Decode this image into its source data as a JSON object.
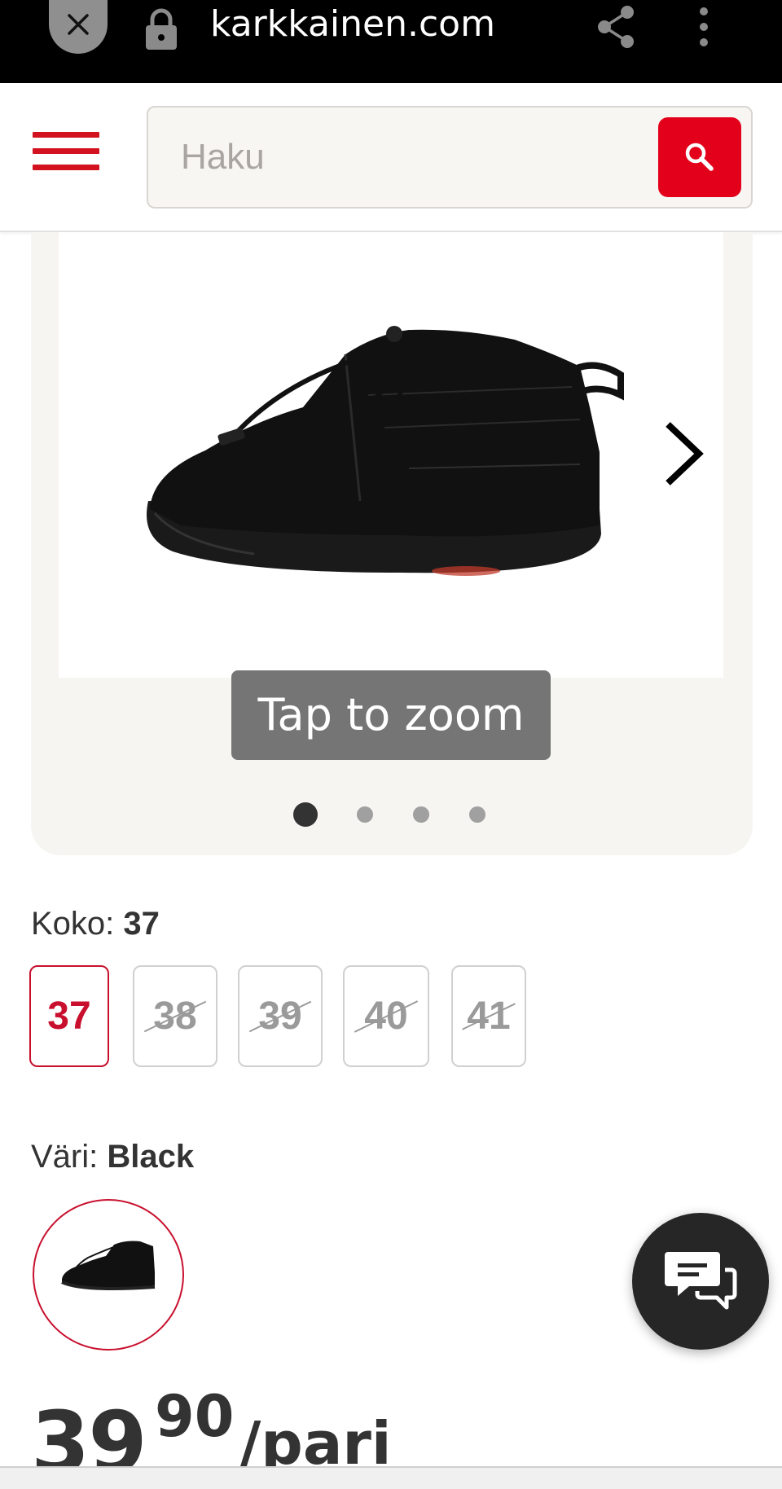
{
  "browser": {
    "url": "karkkainen.com",
    "icons": [
      "close-icon",
      "lock-icon",
      "share-icon",
      "more-vert-icon"
    ]
  },
  "header": {
    "search_placeholder": "Haku",
    "search_value": "",
    "icons": [
      "hamburger-menu-icon",
      "search-icon"
    ],
    "accent_color": "#e2001a"
  },
  "gallery": {
    "zoom_hint": "Tap to zoom",
    "slide_count": 4,
    "active_slide": 1,
    "icons": [
      "chevron-right-icon"
    ]
  },
  "size": {
    "label": "Koko: ",
    "selected": "37",
    "options": [
      {
        "label": "37",
        "available": true,
        "selected": true
      },
      {
        "label": "38",
        "available": false,
        "selected": false
      },
      {
        "label": "39",
        "available": false,
        "selected": false
      },
      {
        "label": "40",
        "available": false,
        "selected": false
      },
      {
        "label": "41",
        "available": false,
        "selected": false
      }
    ]
  },
  "color": {
    "label": "Väri: ",
    "selected": "Black"
  },
  "chat": {
    "icon": "chat-bubbles-icon"
  },
  "price": {
    "integer": "39",
    "decimal": "90",
    "unit": "/pari"
  }
}
